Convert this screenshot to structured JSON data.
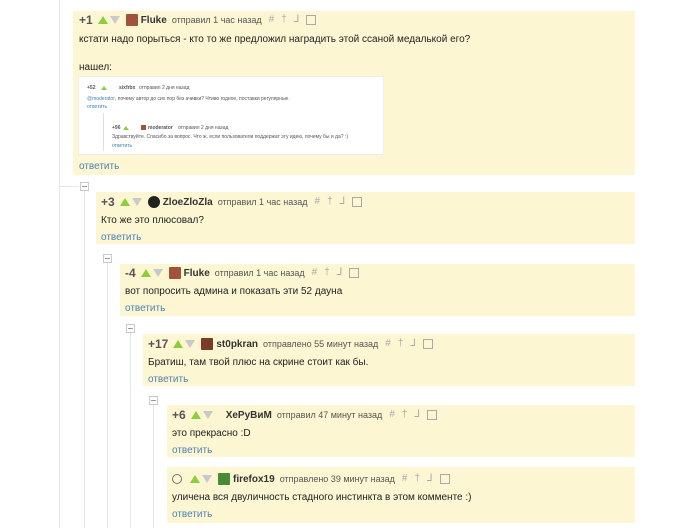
{
  "comments": [
    {
      "rating": "+1",
      "user": "Fluke",
      "time": "отправил 1 час назад",
      "text": "кстати надо порыться - кто то же предложил наградить этой ссаной медалькой его?",
      "text2": "нашел:",
      "reply": "ответить"
    },
    {
      "rating": "+3",
      "user": "ZloeZloZla",
      "time": "отправил 1 час назад",
      "text": "Кто же это плюсовал?",
      "reply": "ответить"
    },
    {
      "rating": "-4",
      "user": "Fluke",
      "time": "отправил 1 час назад",
      "text": "вот попросить админа и показать эти 52 дауна",
      "reply": "ответить"
    },
    {
      "rating": "+17",
      "user": "st0pkran",
      "time": "отправлено 55 минут назад",
      "text": "Братиш, там твой плюс на скрине стоит как бы.",
      "reply": "ответить"
    },
    {
      "rating": "+6",
      "user": "ХеРуВиМ",
      "time": "отправил 47 минут назад",
      "text": "это прекрасно :D",
      "reply": "ответить"
    },
    {
      "rating": "",
      "user": "firefox19",
      "time": "отправлено 39 минут назад",
      "text": "уличена вся двуличность стадного инстинкта в этом комменте :)",
      "reply": "ответить"
    }
  ],
  "screenshot": {
    "c1_rating": "+52",
    "c1_user": "sixfrbx",
    "c1_time": "отправил 2 дня назад",
    "c1_mention": "@moderator",
    "c1_text": ", почему автор до сих пор без ачивки? Чтиво годное, поставки регулярные.",
    "c1_reply": "ответить",
    "c2_rating": "+96",
    "c2_user": "moderator",
    "c2_time": "отправил 2 дня назад",
    "c2_text": "Здравствуйте. Спасибо за вопрос. Что ж, если пользователи поддержат эту идею, почему бы и да? :)",
    "c2_reply": "ответить"
  },
  "colors": {
    "background": "#fdf6d3",
    "link": "#4a82b7",
    "upvote": "#8ccf3c",
    "downvote": "#c9c9c9"
  },
  "icons": [
    "arrow-up-icon",
    "arrow-down-icon",
    "hash-icon",
    "dagger-icon",
    "branch-icon",
    "save-icon",
    "collapse-icon",
    "clock-icon"
  ]
}
